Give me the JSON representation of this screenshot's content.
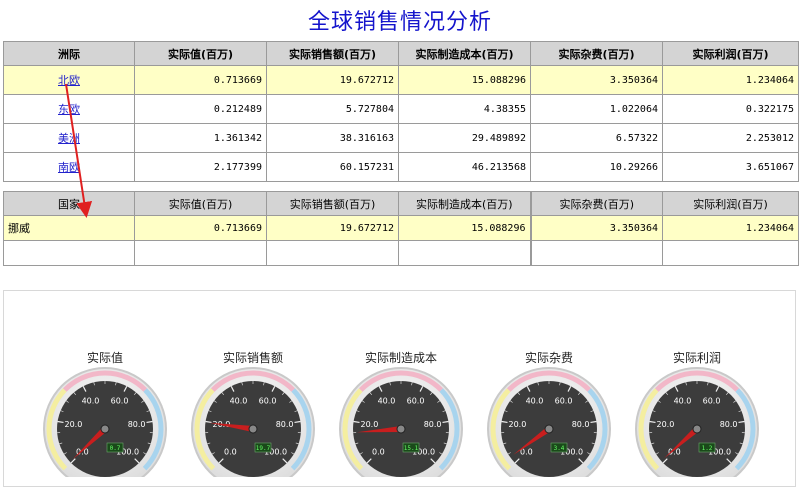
{
  "title": "全球销售情况分析",
  "table1": {
    "headers": [
      "洲际",
      "实际值(百万)",
      "实际销售额(百万)",
      "实际制造成本(百万)",
      "实际杂费(百万)",
      "实际利润(百万)"
    ],
    "rows": [
      {
        "name": "北欧",
        "values": [
          "0.713669",
          "19.672712",
          "15.088296",
          "3.350364",
          "1.234064"
        ]
      },
      {
        "name": "东欧",
        "values": [
          "0.212489",
          "5.727804",
          "4.38355",
          "1.022064",
          "0.322175"
        ]
      },
      {
        "name": "美洲",
        "values": [
          "1.361342",
          "38.316163",
          "29.489892",
          "6.57322",
          "2.253012"
        ]
      },
      {
        "name": "南欧",
        "values": [
          "2.177399",
          "60.157231",
          "46.213568",
          "10.29266",
          "3.651067"
        ]
      }
    ]
  },
  "table2": {
    "headers": [
      "国家",
      "实际值(百万)",
      "实际销售额(百万)",
      "实际制造成本(百万)",
      "实际杂费(百万)",
      "实际利润(百万)"
    ],
    "rows": [
      {
        "name": "挪威",
        "values": [
          "0.713669",
          "19.672712",
          "15.088296",
          "3.350364",
          "1.234064"
        ]
      }
    ]
  },
  "gauges": [
    {
      "label": "实际值",
      "value": 0.7,
      "display": "0.7"
    },
    {
      "label": "实际销售额",
      "value": 19.7,
      "display": "19.7"
    },
    {
      "label": "实际制造成本",
      "value": 15.1,
      "display": "15.1"
    },
    {
      "label": "实际杂费",
      "value": 3.4,
      "display": "3.4"
    },
    {
      "label": "实际利润",
      "value": 1.2,
      "display": "1.2"
    }
  ],
  "gauge_scale": {
    "min": 0,
    "max": 100,
    "ticks": [
      "0.0",
      "20.0",
      "40.0",
      "60.0",
      "80.0",
      "100.0"
    ]
  },
  "colors": {
    "title": "#1414cc",
    "highlight_row": "#ffffc6",
    "header_bg": "#d4d4d4",
    "arrow": "#e02020",
    "needle": "#c81e1e"
  }
}
